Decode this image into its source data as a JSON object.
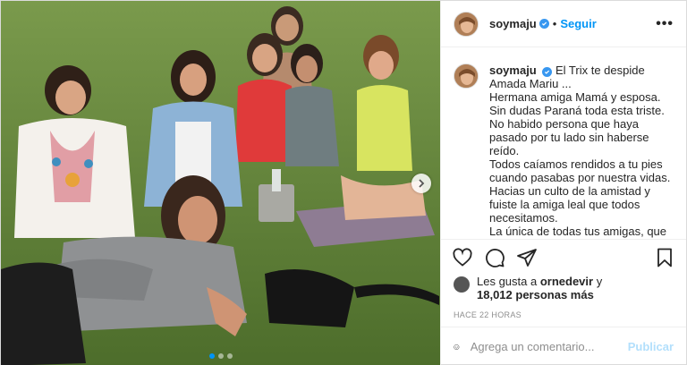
{
  "post": {
    "username": "soymaju",
    "follow_label": "Seguir",
    "separator": "•",
    "more_label": "•••"
  },
  "caption": {
    "username": "soymaju",
    "lines": [
      "El Trix te despide Amada Mariu ...",
      "Hermana amiga Mamá y esposa.",
      "Sin dudas Paraná toda esta triste.",
      "No habido persona que haya pasado por tu lado sin haberse reído.",
      "Todos caíamos rendidos a tu pies cuando pasabas por nuestra vidas.",
      "Hacias un culto de la amistad y fuiste la amiga leal que todos necesitamos.",
      "La única de todas tus amigas, que pudo usar tacos hasta en la playa, la única que se levantaba maquillada y"
    ]
  },
  "likes": {
    "prefix": "Les gusta a",
    "user": "ornedevir",
    "connector": "y",
    "count": "18,012 personas más"
  },
  "timestamp": "HACE 22 HORAS",
  "comment": {
    "placeholder": "Agrega un comentario...",
    "publish_label": "Publicar"
  },
  "carousel": {
    "total": 3,
    "active": 1
  },
  "icons": {
    "like": "heart-icon",
    "comment": "comment-icon",
    "share": "share-icon",
    "save": "bookmark-icon",
    "emoji": "emoji-icon",
    "next": "chevron-right-icon"
  },
  "colors": {
    "accent": "#0095f6",
    "verified": "#3897f0",
    "publish_disabled": "#b2dffc",
    "meta_text": "#8e8e8e"
  }
}
